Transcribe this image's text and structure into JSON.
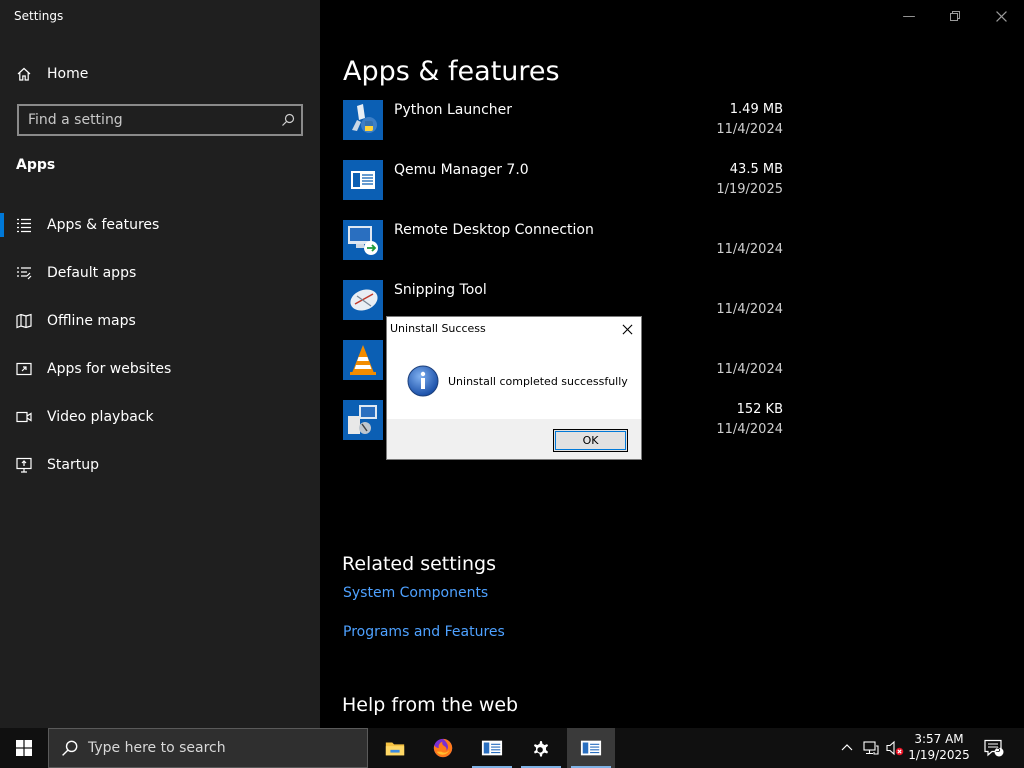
{
  "window": {
    "title": "Settings"
  },
  "sidebar": {
    "home_label": "Home",
    "search_placeholder": "Find a setting",
    "section_title": "Apps",
    "items": [
      {
        "label": "Apps & features",
        "icon": "list-icon",
        "active": true
      },
      {
        "label": "Default apps",
        "icon": "default-apps-icon"
      },
      {
        "label": "Offline maps",
        "icon": "map-icon"
      },
      {
        "label": "Apps for websites",
        "icon": "apps-websites-icon"
      },
      {
        "label": "Video playback",
        "icon": "video-icon"
      },
      {
        "label": "Startup",
        "icon": "startup-icon"
      }
    ]
  },
  "main": {
    "title": "Apps & features",
    "apps": [
      {
        "name": "Python Launcher",
        "size": "1.49 MB",
        "date": "11/4/2024",
        "icon": "python-launcher-icon"
      },
      {
        "name": "Qemu Manager 7.0",
        "size": "43.5 MB",
        "date": "1/19/2025",
        "icon": "qemu-manager-icon"
      },
      {
        "name": "Remote Desktop Connection",
        "size": "",
        "date": "11/4/2024",
        "icon": "remote-desktop-icon"
      },
      {
        "name": "Snipping Tool",
        "size": "",
        "date": "11/4/2024",
        "icon": "snipping-tool-icon"
      },
      {
        "name": "",
        "size": "",
        "date": "11/4/2024",
        "icon": "vlc-icon"
      },
      {
        "name": "",
        "size": "152 KB",
        "date": "11/4/2024",
        "icon": "installer-icon"
      }
    ],
    "related_title": "Related settings",
    "related_links": [
      "System Components",
      "Programs and Features"
    ],
    "help_title": "Help from the web"
  },
  "dialog": {
    "title": "Uninstall Success",
    "message": "Uninstall completed successfully",
    "ok_label": "OK"
  },
  "taskbar": {
    "search_placeholder": "Type here to search",
    "time": "3:57 AM",
    "date": "1/19/2025",
    "notification_count": "3"
  },
  "colors": {
    "accent": "#0078d7",
    "link": "#4ea1ff",
    "sidebar_bg": "#1f1f1f",
    "main_bg": "#000000"
  }
}
